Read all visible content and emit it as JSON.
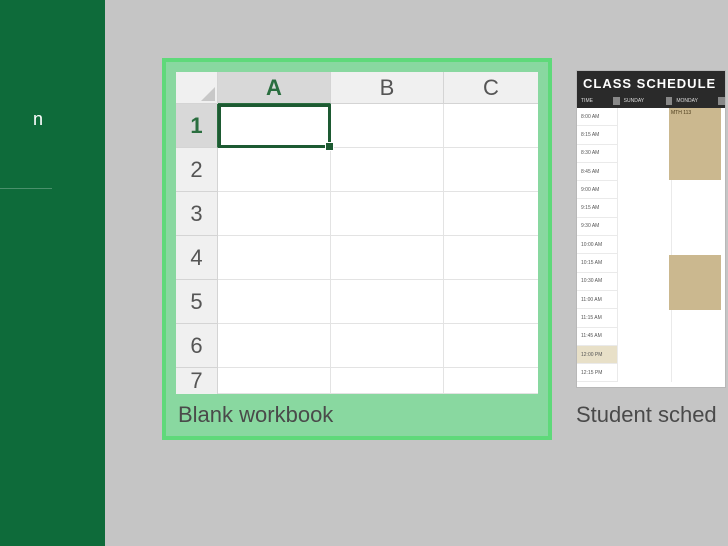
{
  "sidebar": {
    "partial_text": "n"
  },
  "templates": {
    "blank": {
      "label": "Blank workbook",
      "columns": [
        "A",
        "B",
        "C"
      ],
      "rows": [
        "1",
        "2",
        "3",
        "4",
        "5",
        "6",
        "7"
      ],
      "selected_cell": "A1"
    },
    "schedule": {
      "label": "Student sched",
      "title": "CLASS SCHEDULE",
      "header_cols": [
        "TIME",
        "SUNDAY",
        "MONDAY"
      ],
      "class_label": "MTH 113",
      "time_slots": [
        "8:00 AM",
        "8:15 AM",
        "8:30 AM",
        "8:45 AM",
        "9:00 AM",
        "9:15 AM",
        "9:30 AM",
        "10:00 AM",
        "10:15 AM",
        "10:30 AM",
        "11:00 AM",
        "11:15 AM",
        "11:45 AM",
        "12:00 PM",
        "12:15 PM"
      ],
      "highlight_index": 13
    }
  },
  "colors": {
    "sidebar_bg": "#0e6b3a",
    "highlight_border": "#5fd97a",
    "highlight_fill": "#89d8a0",
    "selection": "#1d5a32"
  }
}
